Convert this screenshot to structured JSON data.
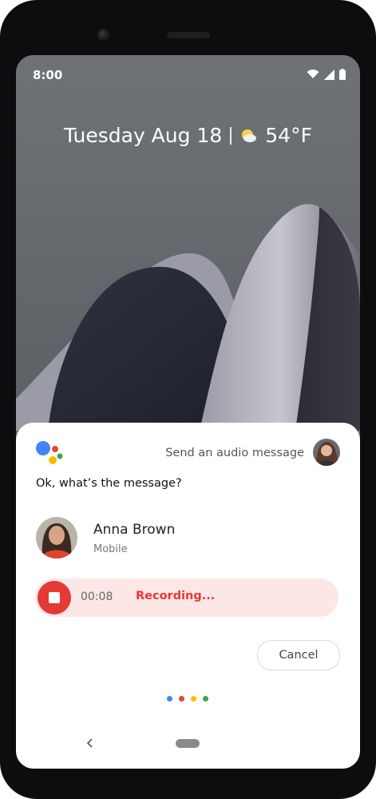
{
  "status_bar": {
    "time": "8:00",
    "icons": [
      "wifi-icon",
      "cell-signal-icon",
      "battery-icon"
    ]
  },
  "lockscreen": {
    "date": "Tuesday Aug 18",
    "weather_icon": "partly-sunny-icon",
    "temperature": "54°F"
  },
  "assistant": {
    "logo": "google-assistant-logo",
    "prompt_label": "Send an audio message",
    "response_text": "Ok, what’s the message?"
  },
  "contact": {
    "name": "Anna Brown",
    "type": "Mobile"
  },
  "recorder": {
    "elapsed": "00:08",
    "status": "Recording..."
  },
  "actions": {
    "cancel_label": "Cancel"
  },
  "navigation": {
    "back_icon": "back-chevron-icon",
    "home_pill": "home-pill"
  },
  "colors": {
    "google_blue": "#4285F4",
    "google_red": "#EA4335",
    "google_yellow": "#FBBC05",
    "google_green": "#34A853",
    "record_red": "#E53935",
    "record_bg": "#FDE6E6"
  }
}
